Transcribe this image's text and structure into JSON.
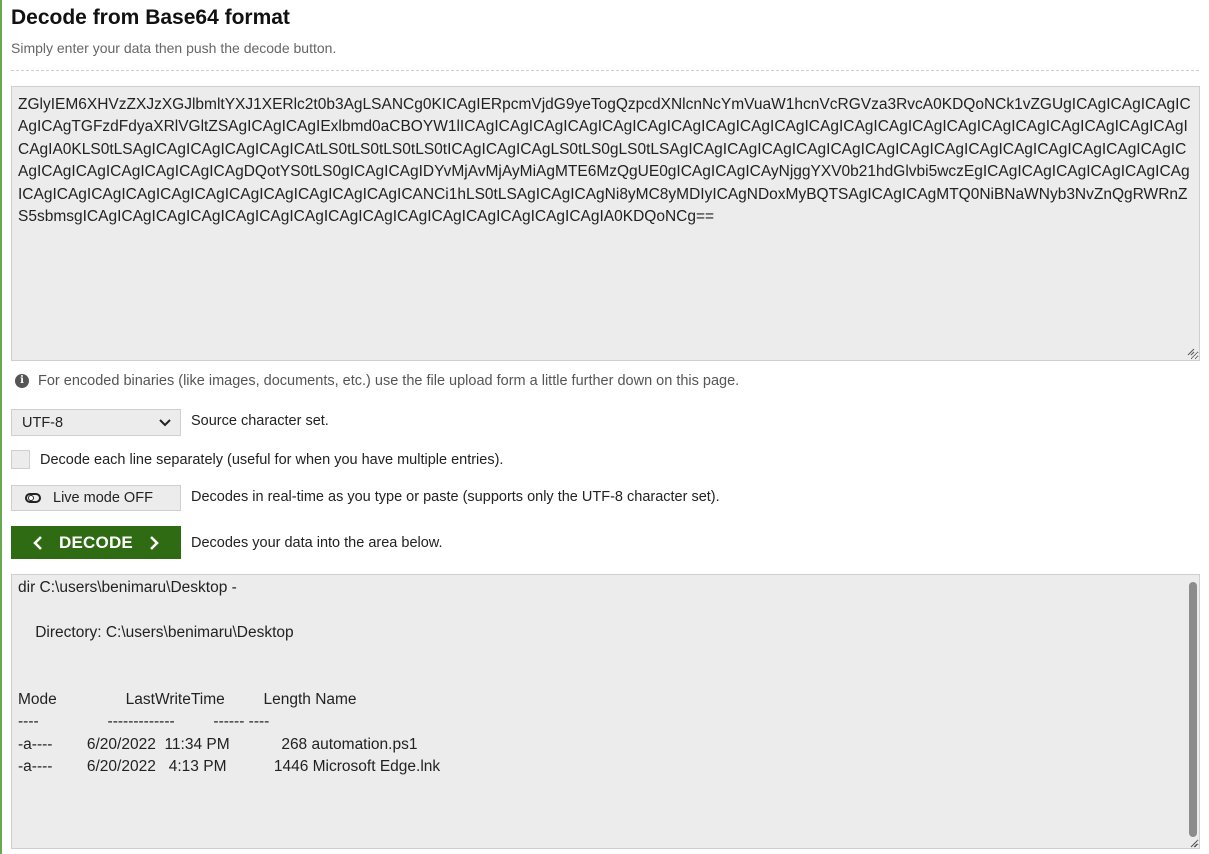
{
  "header": {
    "title": "Decode from Base64 format",
    "subtitle": "Simply enter your data then push the decode button."
  },
  "input": {
    "value": "ZGlyIEM6XHVzZXJzXGJlbmltYXJ1XERlc2t0b3AgLSANCg0KICAgIERpcmVjdG9yeTogQzpcdXNlcnNcYmVuaW1hcnVcRGVza3RvcA0KDQoNCk1vZGUgICAgICAgICAgICAgICAgTGFzdFdyaXRlVGltZSAgICAgICAgIExlbmd0aCBOYW1lICAgICAgICAgICAgICAgICAgICAgICAgICAgICAgICAgICAgICAgICAgICAgICAgICAgICAgICAgICAgICAgICAgIA0KLS0tLSAgICAgICAgICAgICAgICAtLS0tLS0tLS0tLS0tICAgICAgICAgLS0tLS0gLS0tLSAgICAgICAgICAgICAgICAgICAgICAgICAgICAgICAgICAgICAgICAgICAgICAgICAgICAgICAgICAgICAgICAgDQotYS0tLS0gICAgICAgIDYvMjAvMjAyMiAgMTE6MzQgUE0gICAgICAgICAyNjggYXV0b21hdGlvbi5wczEgICAgICAgICAgICAgICAgICAgICAgICAgICAgICAgICAgICAgICAgICAgICAgICAgICAgICANCi1hLS0tLSAgICAgICAgNi8yMC8yMDIyICAgNDoxMyBQTSAgICAgICAgMTQ0NiBNaWNyb3NvZnQgRWRnZS5sbmsgICAgICAgICAgICAgICAgICAgICAgICAgICAgICAgICAgICAgICAgICAgICAgIA0KDQoNCg=="
  },
  "info": {
    "icon": "info-icon",
    "text": "For encoded binaries (like images, documents, etc.) use the file upload form a little further down on this page."
  },
  "charset": {
    "selected": "UTF-8",
    "label": "Source character set."
  },
  "per_line": {
    "checked": false,
    "label": "Decode each line separately (useful for when you have multiple entries)."
  },
  "live_mode": {
    "button_label": "Live mode OFF",
    "description": "Decodes in real-time as you type or paste (supports only the UTF-8 character set)."
  },
  "decode": {
    "button_label": "DECODE",
    "description": "Decodes your data into the area below."
  },
  "output": {
    "value": "dir C:\\users\\benimaru\\Desktop -\n\n    Directory: C:\\users\\benimaru\\Desktop\n\n\nMode                LastWriteTime         Length Name\n----                -------------         ------ ----\n-a----        6/20/2022  11:34 PM            268 automation.ps1\n-a----        6/20/2022   4:13 PM           1446 Microsoft Edge.lnk\n\n\n"
  },
  "colors": {
    "accent": "#2e6b12",
    "textarea_bg": "#ececec"
  }
}
